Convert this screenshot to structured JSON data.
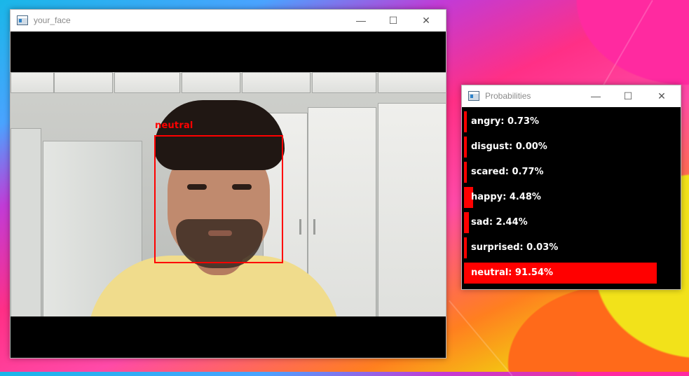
{
  "face_window": {
    "title": "your_face",
    "detected_label": "neutral"
  },
  "prob_window": {
    "title": "Probabilities",
    "rows": [
      {
        "text": "angry: 0.73%",
        "value": 0.73
      },
      {
        "text": "disgust: 0.00%",
        "value": 0.0
      },
      {
        "text": "scared: 0.77%",
        "value": 0.77
      },
      {
        "text": "happy: 4.48%",
        "value": 4.48
      },
      {
        "text": "sad: 2.44%",
        "value": 2.44
      },
      {
        "text": "surprised: 0.03%",
        "value": 0.03
      },
      {
        "text": "neutral: 91.54%",
        "value": 91.54
      }
    ]
  },
  "window_controls": {
    "minimize": "—",
    "maximize": "☐",
    "close": "✕"
  },
  "colors": {
    "highlight": "#ff0000",
    "panel_bg": "#000000"
  }
}
